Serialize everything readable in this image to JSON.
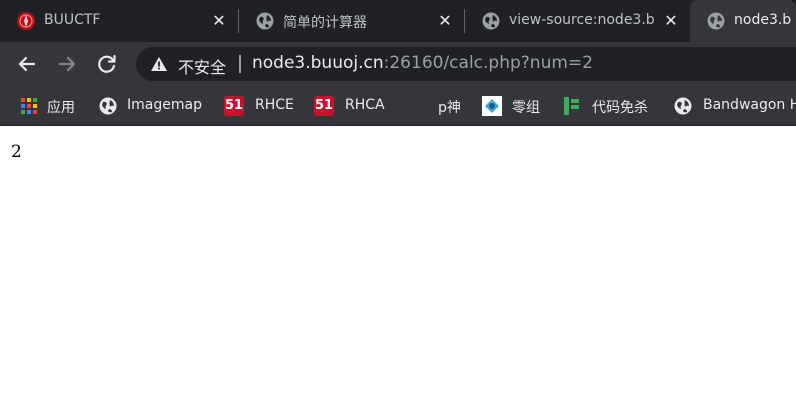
{
  "tabs": [
    {
      "title": "BUUCTF",
      "icon": "buuctf-logo-icon",
      "close": "✕",
      "active": false
    },
    {
      "title": "简单的计算器",
      "icon": "globe-icon",
      "close": "✕",
      "active": false
    },
    {
      "title": "view-source:node3.b",
      "icon": "globe-icon",
      "close": "✕",
      "active": false
    },
    {
      "title": "node3.b",
      "icon": "globe-icon",
      "active": true
    }
  ],
  "toolbar": {
    "security_label": "不安全",
    "url_host": "node3.buuoj.cn",
    "url_rest": ":26160/calc.php?num=2"
  },
  "bookmarks": [
    {
      "label": "应用",
      "icon": "apps-grid-icon"
    },
    {
      "label": "Imagemap",
      "icon": "globe-icon"
    },
    {
      "label": "RHCE",
      "icon": "51cto-icon",
      "icon_text": "51"
    },
    {
      "label": "RHCA",
      "icon": "51cto-icon",
      "icon_text": "51"
    },
    {
      "label": "p神",
      "icon": "none"
    },
    {
      "label": "零组",
      "icon": "zero-group-icon"
    },
    {
      "label": "代码免杀",
      "icon": "green-doc-icon"
    },
    {
      "label": "Bandwagon H",
      "icon": "globe-icon"
    }
  ],
  "page": {
    "output": "2"
  },
  "colors": {
    "tabstrip": "#202124",
    "toolbar": "#35363a",
    "text": "#e8eaed",
    "muted": "#9aa0a6",
    "cto_red": "#c8102e",
    "buu_red": "#b3121c"
  }
}
